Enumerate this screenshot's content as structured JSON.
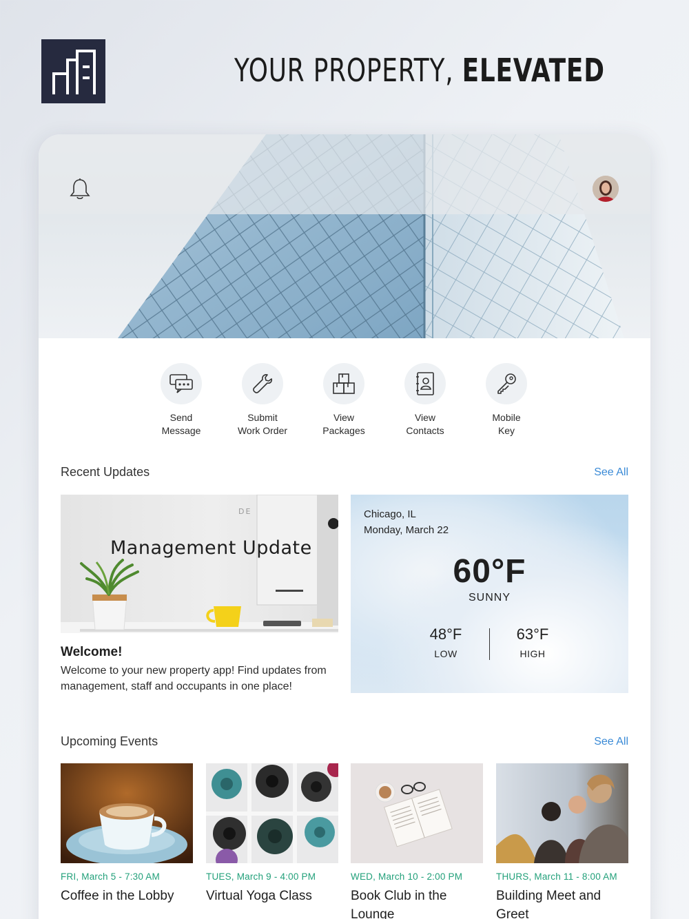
{
  "header": {
    "tagline_light": "YOUR PROPERTY, ",
    "tagline_bold": "ELEVATED"
  },
  "icons": {
    "logo": "building-logo",
    "notification": "bell-icon",
    "profile": "avatar"
  },
  "quick_actions": [
    {
      "label": "Send\nMessage",
      "icon": "message-icon"
    },
    {
      "label": "Submit\nWork Order",
      "icon": "wrench-icon"
    },
    {
      "label": "View\nPackages",
      "icon": "packages-icon"
    },
    {
      "label": "View\nContacts",
      "icon": "contacts-icon"
    },
    {
      "label": "Mobile\nKey",
      "icon": "key-icon"
    }
  ],
  "recent_updates": {
    "title": "Recent Updates",
    "see_all": "See All",
    "post": {
      "image_title": "Management Update",
      "heading": "Welcome!",
      "body": "Welcome to your new property app! Find updates from management, staff and occupants in one place!"
    },
    "weather": {
      "city": "Chicago, IL",
      "date": "Monday, March 22",
      "temp": "60°F",
      "condition": "SUNNY",
      "low": "48°F",
      "low_label": "LOW",
      "high": "63°F",
      "high_label": "HIGH"
    }
  },
  "upcoming_events": {
    "title": "Upcoming Events",
    "see_all": "See All",
    "items": [
      {
        "when": "FRI, March 5 - 7:30 AM",
        "name": "Coffee in the Lobby"
      },
      {
        "when": "TUES, March 9 - 4:00 PM",
        "name": "Virtual Yoga Class"
      },
      {
        "when": "WED, March 10 - 2:00 PM",
        "name": "Book Club in the Lounge"
      },
      {
        "when": "THURS, March 11 - 8:00 AM",
        "name": "Building Meet and Greet"
      }
    ]
  },
  "colors": {
    "accent_link": "#3a8ad6",
    "event_date": "#22a07a",
    "logo_bg": "#262a3f"
  }
}
